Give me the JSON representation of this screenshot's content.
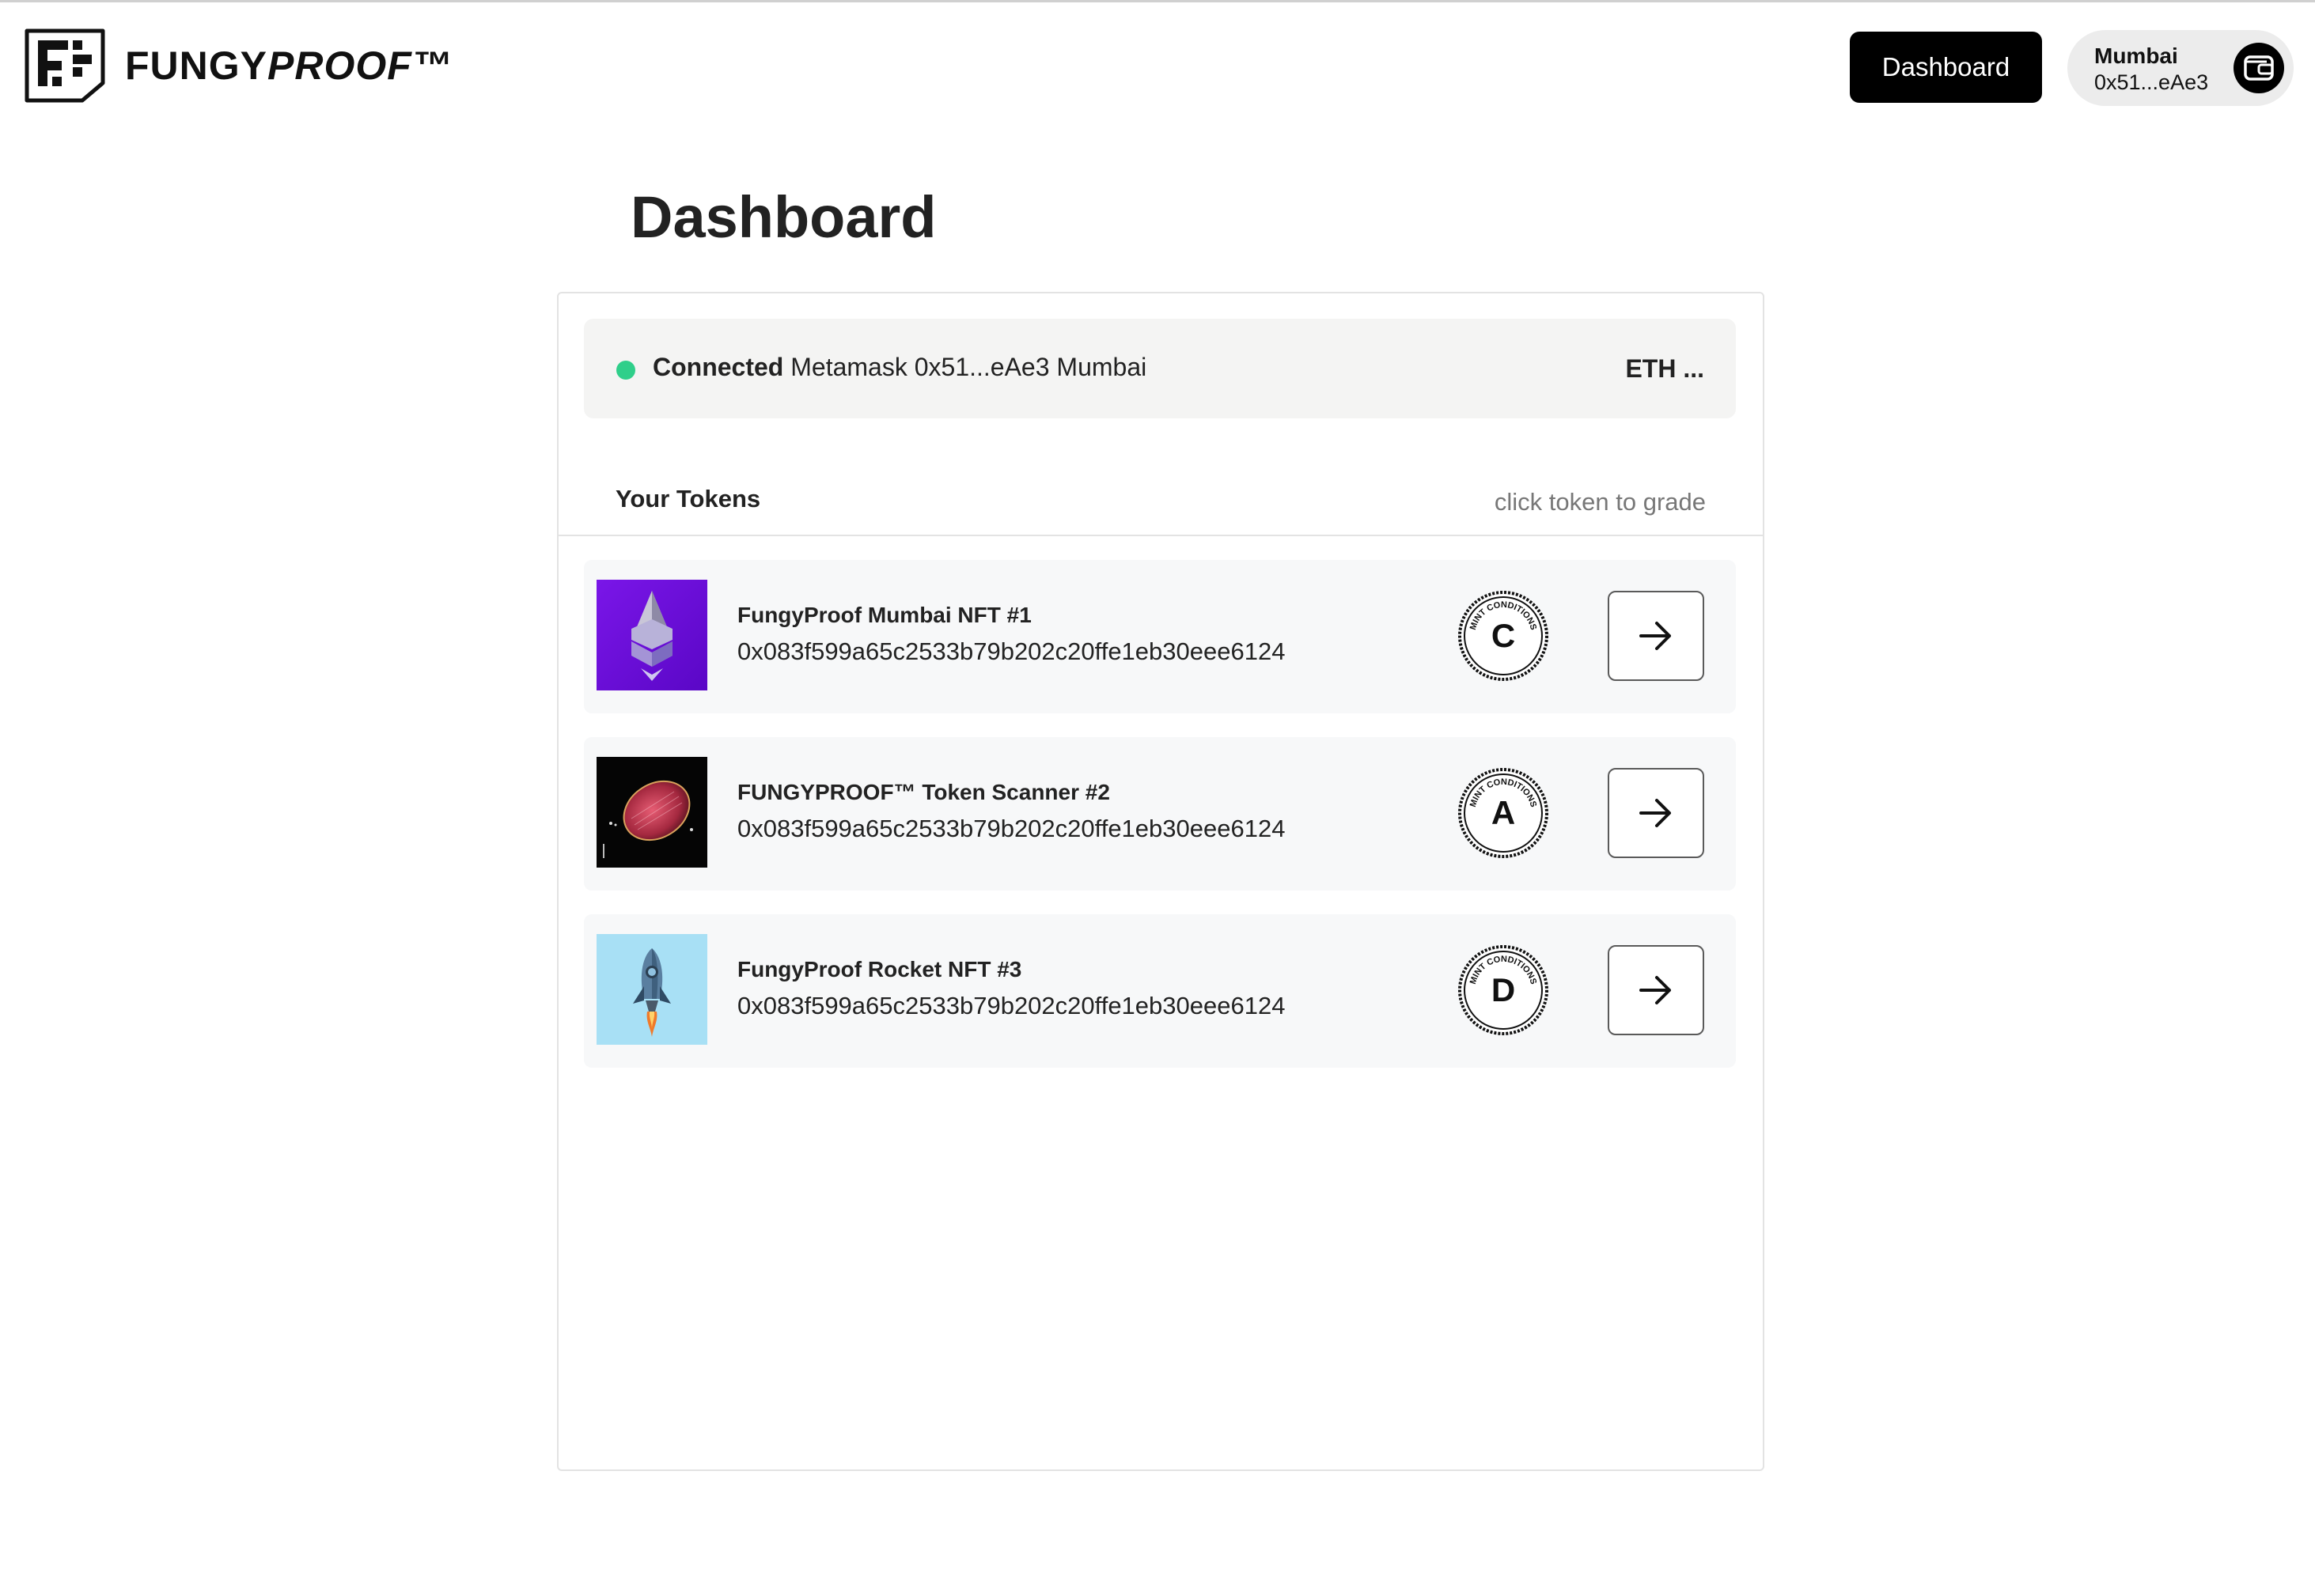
{
  "header": {
    "logo_text_plain": "FUNGY",
    "logo_text_italic": "PROOF™",
    "dashboard_button": "Dashboard",
    "wallet": {
      "network": "Mumbai",
      "address": "0x51...eAe3",
      "icon": "wallet-icon"
    }
  },
  "page": {
    "title": "Dashboard"
  },
  "connection": {
    "status": "Connected",
    "details": "Metamask 0x51...eAe3 Mumbai",
    "currency": "ETH ...",
    "status_color": "#2fcf8a"
  },
  "tokens": {
    "title": "Your Tokens",
    "hint": "click token to grade",
    "items": [
      {
        "name": "FungyProof Mumbai NFT #1",
        "address": "0x083f599a65c2533b79b202c20ffe1eb30eee6124",
        "grade": "C",
        "seal_text": "MINT CONDITIONS",
        "thumb": "purple-ethereum-image"
      },
      {
        "name": "FUNGYPROOF™ Token Scanner #2",
        "address": "0x083f599a65c2533b79b202c20ffe1eb30eee6124",
        "grade": "A",
        "seal_text": "MINT CONDITIONS",
        "thumb": "red-disc-image"
      },
      {
        "name": "FungyProof Rocket NFT #3",
        "address": "0x083f599a65c2533b79b202c20ffe1eb30eee6124",
        "grade": "D",
        "seal_text": "MINT CONDITIONS",
        "thumb": "rocket-image"
      }
    ]
  }
}
